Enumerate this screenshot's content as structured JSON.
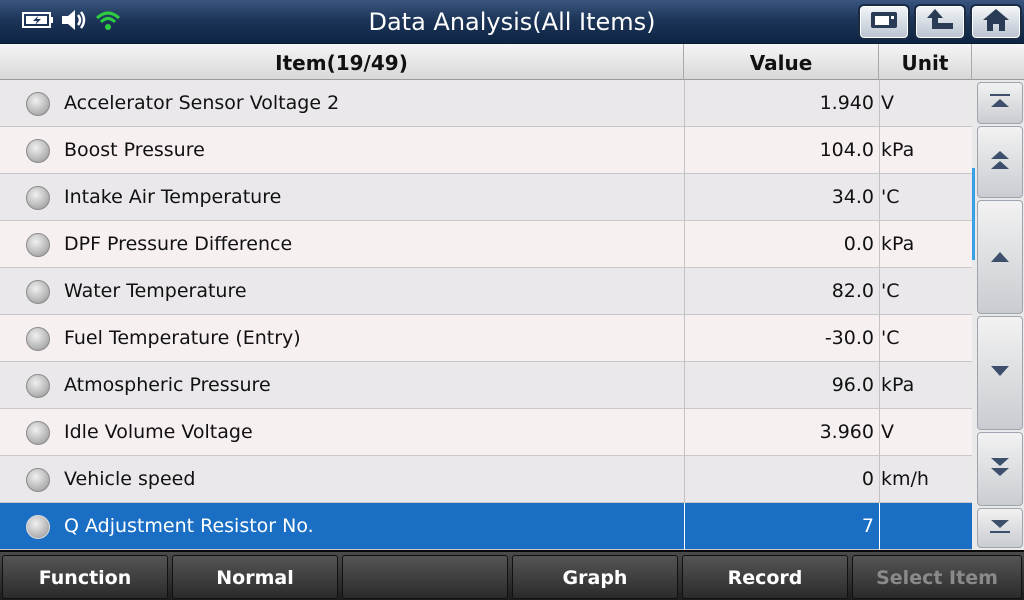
{
  "window": {
    "title": "Data Analysis(All Items)"
  },
  "status_icons": [
    "battery-charging-icon",
    "speaker-icon",
    "wifi-icon"
  ],
  "toolbar": {
    "buttons": [
      {
        "icon": "print-icon"
      },
      {
        "icon": "back-arrow-icon"
      },
      {
        "icon": "home-icon"
      }
    ]
  },
  "table": {
    "headers": {
      "item": "Item(19/49)",
      "value": "Value",
      "unit": "Unit"
    },
    "rows": [
      {
        "name": "Accelerator Sensor Voltage 2",
        "value": "1.940",
        "unit": "V"
      },
      {
        "name": "Boost Pressure",
        "value": "104.0",
        "unit": "kPa"
      },
      {
        "name": "Intake Air Temperature",
        "value": "34.0",
        "unit": "'C"
      },
      {
        "name": "DPF Pressure Difference",
        "value": "0.0",
        "unit": "kPa"
      },
      {
        "name": "Water Temperature",
        "value": "82.0",
        "unit": "'C"
      },
      {
        "name": "Fuel Temperature (Entry)",
        "value": "-30.0",
        "unit": "'C"
      },
      {
        "name": "Atmospheric Pressure",
        "value": "96.0",
        "unit": "kPa"
      },
      {
        "name": "Idle Volume Voltage",
        "value": "3.960",
        "unit": "V"
      },
      {
        "name": "Vehicle speed",
        "value": "0",
        "unit": "km/h"
      },
      {
        "name": "Q Adjustment Resistor No.",
        "value": "7",
        "unit": ""
      }
    ],
    "selected_index": 9
  },
  "scroll_buttons": [
    "scroll-top-icon",
    "page-up-icon",
    "scroll-up-icon",
    "scroll-down-icon",
    "page-down-icon",
    "scroll-bottom-icon"
  ],
  "bottom_bar": {
    "buttons": [
      {
        "label": "Function",
        "enabled": true
      },
      {
        "label": "Normal",
        "enabled": true
      },
      {
        "label": "",
        "enabled": true
      },
      {
        "label": "Graph",
        "enabled": true
      },
      {
        "label": "Record",
        "enabled": true
      },
      {
        "label": "Select Item",
        "enabled": false
      }
    ]
  },
  "colors": {
    "selected_row": "#1a6fc5",
    "title_bar": "#1d3558",
    "scroll_indicator": "#3aa0e6"
  }
}
